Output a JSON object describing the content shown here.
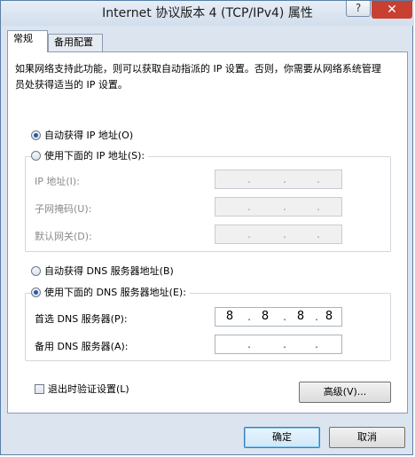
{
  "window": {
    "title": "Internet 协议版本 4 (TCP/IPv4) 属性",
    "help_label": "?",
    "close_label": "✕"
  },
  "tabs": [
    {
      "label": "常规",
      "active": true
    },
    {
      "label": "备用配置",
      "active": false
    }
  ],
  "general": {
    "description": "如果网络支持此功能，则可以获取自动指派的 IP 设置。否则，你需要从网络系统管理员处获得适当的 IP 设置。",
    "auto_ip_label": "自动获得 IP 地址(O)",
    "auto_ip_selected": true,
    "manual_ip_label": "使用下面的 IP 地址(S):",
    "manual_ip_selected": false,
    "ip_fields": [
      {
        "label": "IP 地址(I):",
        "value": [
          "",
          "",
          "",
          ""
        ]
      },
      {
        "label": "子网掩码(U):",
        "value": [
          "",
          "",
          "",
          ""
        ]
      },
      {
        "label": "默认网关(D):",
        "value": [
          "",
          "",
          "",
          ""
        ]
      }
    ],
    "auto_dns_label": "自动获得 DNS 服务器地址(B)",
    "auto_dns_selected": false,
    "manual_dns_label": "使用下面的 DNS 服务器地址(E):",
    "manual_dns_selected": true,
    "dns_fields": [
      {
        "label": "首选 DNS 服务器(P):",
        "value": [
          "8",
          "8",
          "8",
          "8"
        ]
      },
      {
        "label": "备用 DNS 服务器(A):",
        "value": [
          "",
          "",
          "",
          ""
        ]
      }
    ],
    "validate_label": "退出时验证设置(L)",
    "validate_checked": false,
    "advanced_label": "高级(V)..."
  },
  "footer": {
    "ok_label": "确定",
    "cancel_label": "取消"
  },
  "colors": {
    "titlebar": "#d2deec",
    "close": "#c84031",
    "radio_dot": "#2a59a8",
    "default_button_border": "#3c7fb1"
  }
}
